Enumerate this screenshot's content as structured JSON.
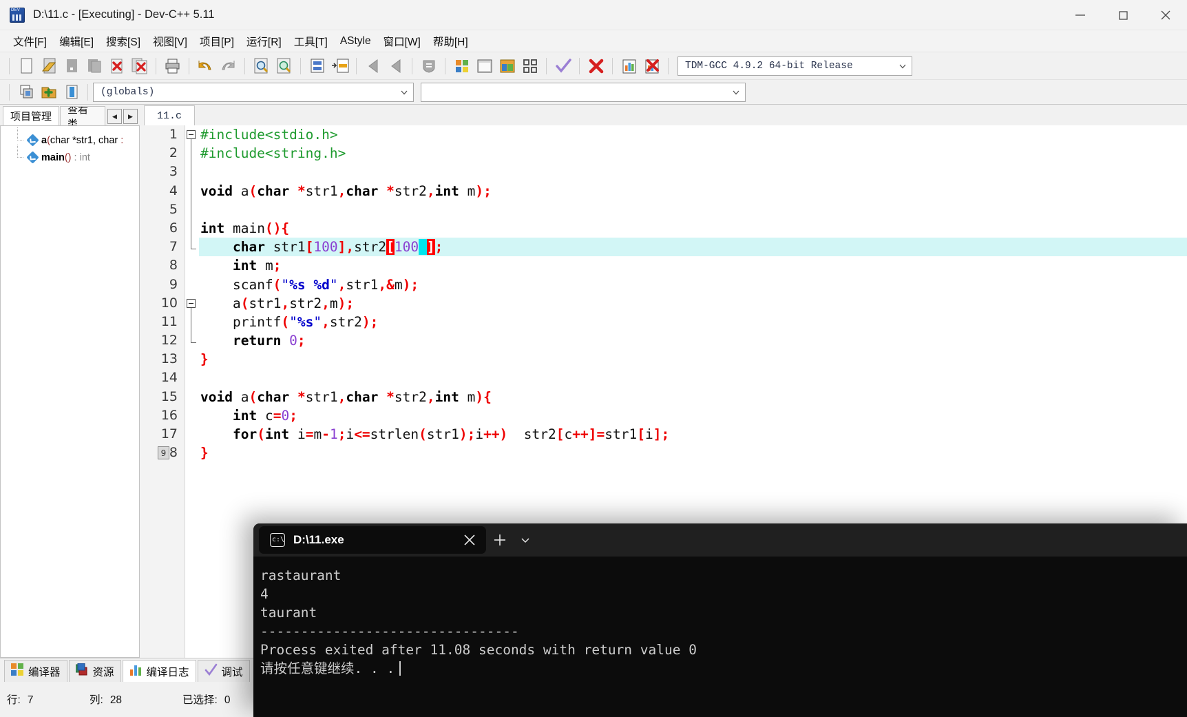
{
  "window": {
    "title": "D:\\11.c - [Executing] - Dev-C++ 5.11",
    "app_icon": "devcpp-icon",
    "minimize": "minimize-icon",
    "maximize": "maximize-icon",
    "close": "close-icon"
  },
  "menubar": {
    "items": [
      {
        "label": "文件[F]",
        "name": "menu-file"
      },
      {
        "label": "编辑[E]",
        "name": "menu-edit"
      },
      {
        "label": "搜索[S]",
        "name": "menu-search"
      },
      {
        "label": "视图[V]",
        "name": "menu-view"
      },
      {
        "label": "项目[P]",
        "name": "menu-project"
      },
      {
        "label": "运行[R]",
        "name": "menu-run"
      },
      {
        "label": "工具[T]",
        "name": "menu-tools"
      },
      {
        "label": "AStyle",
        "name": "menu-astyle"
      },
      {
        "label": "窗口[W]",
        "name": "menu-window"
      },
      {
        "label": "帮助[H]",
        "name": "menu-help"
      }
    ]
  },
  "toolbar": {
    "compiler_combo": {
      "value": "TDM-GCC 4.9.2 64-bit Release",
      "caret": "chevron-down-icon"
    },
    "scope_combo": {
      "value": "(globals)",
      "caret": "chevron-down-icon"
    },
    "member_combo": {
      "value": "",
      "caret": "chevron-down-icon"
    }
  },
  "left_panel": {
    "tabs": [
      {
        "label": "项目管理",
        "name": "tab-project-manager",
        "active": true
      },
      {
        "label": "查看类",
        "name": "tab-class-browser",
        "active": false
      }
    ],
    "nav_prev": "prev-arrow-icon",
    "nav_next": "next-arrow-icon",
    "tree": [
      {
        "label_html": "<b>a</b><span class='tn-paren'>(</span>char *str1, char <span class='tn-paren'>:</span>",
        "name": "class-tree-item-a"
      },
      {
        "label_html": "<b>main</b><span class='tn-paren'>()</span> <span class='tn-type'>: int</span>",
        "name": "class-tree-item-main"
      }
    ]
  },
  "editor": {
    "tabs": [
      {
        "label": "11.c",
        "name": "editor-tab-11c",
        "active": true
      }
    ],
    "lines": [
      {
        "n": "1",
        "html": "<span class='pp'>#include&lt;stdio.h&gt;</span>"
      },
      {
        "n": "2",
        "html": "<span class='pp'>#include&lt;string.h&gt;</span>"
      },
      {
        "n": "3",
        "html": ""
      },
      {
        "n": "4",
        "html": "<span class='kw'>void</span> <span class='ident'>a</span><span class='punc'>(</span><span class='kw'>char</span> <span class='punc'>*</span><span class='ident'>str1</span><span class='punc'>,</span><span class='kw'>char</span> <span class='punc'>*</span><span class='ident'>str2</span><span class='punc'>,</span><span class='kw'>int</span> <span class='ident'>m</span><span class='punc'>);</span>"
      },
      {
        "n": "5",
        "html": ""
      },
      {
        "n": "6",
        "html": "<span class='kw'>int</span> <span class='ident'>main</span><span class='punc'>(){</span>"
      },
      {
        "n": "7",
        "html": "    <span class='kw'>char</span> <span class='ident'>str1</span><span class='punc'>[</span><span class='num'>100</span><span class='punc'>],</span><span class='ident'>str2</span><span class='brkt'>[</span><span class='num'>100</span><span class='sel'>&nbsp;</span><span class='brkt'>]</span><span class='punc'>;</span>",
        "highlight": true
      },
      {
        "n": "8",
        "html": "    <span class='kw'>int</span> <span class='ident'>m</span><span class='punc'>;</span>"
      },
      {
        "n": "9",
        "html": "    <span class='ident'>scanf</span><span class='punc'>(</span><span class='str'>\"</span><span class='fmt'>%s %d</span><span class='str'>\"</span><span class='punc'>,</span><span class='ident'>str1</span><span class='punc'>,&amp;</span><span class='ident'>m</span><span class='punc'>);</span>"
      },
      {
        "n": "10",
        "html": "    <span class='ident'>a</span><span class='punc'>(</span><span class='ident'>str1</span><span class='punc'>,</span><span class='ident'>str2</span><span class='punc'>,</span><span class='ident'>m</span><span class='punc'>);</span>"
      },
      {
        "n": "11",
        "html": "    <span class='ident'>printf</span><span class='punc'>(</span><span class='str'>\"</span><span class='fmt'>%s</span><span class='str'>\"</span><span class='punc'>,</span><span class='ident'>str2</span><span class='punc'>);</span>"
      },
      {
        "n": "12",
        "html": "    <span class='kw'>return</span> <span class='num'>0</span><span class='punc'>;</span>"
      },
      {
        "n": "13",
        "html": "<span class='punc'>}</span>"
      },
      {
        "n": "14",
        "html": ""
      },
      {
        "n": "15",
        "html": "<span class='kw'>void</span> <span class='ident'>a</span><span class='punc'>(</span><span class='kw'>char</span> <span class='punc'>*</span><span class='ident'>str1</span><span class='punc'>,</span><span class='kw'>char</span> <span class='punc'>*</span><span class='ident'>str2</span><span class='punc'>,</span><span class='kw'>int</span> <span class='ident'>m</span><span class='punc'>){</span>"
      },
      {
        "n": "16",
        "html": "    <span class='kw'>int</span> <span class='ident'>c</span><span class='punc'>=</span><span class='num'>0</span><span class='punc'>;</span>"
      },
      {
        "n": "17",
        "html": "    <span class='kw'>for</span><span class='punc'>(</span><span class='kw'>int</span> <span class='ident'>i</span><span class='punc'>=</span><span class='ident'>m</span><span class='punc'>-</span><span class='num'>1</span><span class='punc'>;</span><span class='ident'>i</span><span class='punc'>&lt;=</span><span class='ident'>strlen</span><span class='punc'>(</span><span class='ident'>str1</span><span class='punc'>);</span><span class='ident'>i</span><span class='punc'>++)</span>  <span class='ident'>str2</span><span class='punc'>[</span><span class='ident'>c</span><span class='punc'>++]=</span><span class='ident'>str1</span><span class='punc'>[</span><span class='ident'>i</span><span class='punc'>];</span>"
      },
      {
        "n": "18",
        "html": "<span class='punc'>}</span>"
      }
    ]
  },
  "bottom_panel": {
    "tabs": [
      {
        "label": "编译器",
        "name": "tab-compiler",
        "icon": "grid-squares-icon",
        "active": false
      },
      {
        "label": "资源",
        "name": "tab-resources",
        "icon": "layers-icon",
        "active": false
      },
      {
        "label": "编译日志",
        "name": "tab-compile-log",
        "icon": "bar-chart-icon",
        "active": true
      },
      {
        "label": "调试",
        "name": "tab-debug",
        "icon": "check-icon",
        "active": false
      }
    ],
    "status": [
      {
        "label": "行:",
        "value": "7",
        "name": "status-line"
      },
      {
        "label": "列:",
        "value": "28",
        "name": "status-column"
      },
      {
        "label": "已选择:",
        "value": "0",
        "name": "status-selected"
      }
    ]
  },
  "console": {
    "icon": "terminal-icon",
    "title": "D:\\11.exe",
    "close": "close-icon",
    "new_tab": "plus-icon",
    "dropdown": "chevron-down-icon",
    "output": [
      "rastaurant",
      "4",
      "taurant",
      "--------------------------------",
      "Process exited after 11.08 seconds with return value 0",
      "请按任意键继续. . ."
    ]
  },
  "colors": {
    "accent": "#3b8fd4",
    "selection": "#00e5ee",
    "highlight_line": "#d2f6f6",
    "bracket_match": "#ff0000",
    "preprocessor": "#1f9b2f",
    "string": "#0000cc",
    "number": "#8a3fd1",
    "punctuation": "#ee0000",
    "console_bg": "#0c0c0c"
  }
}
